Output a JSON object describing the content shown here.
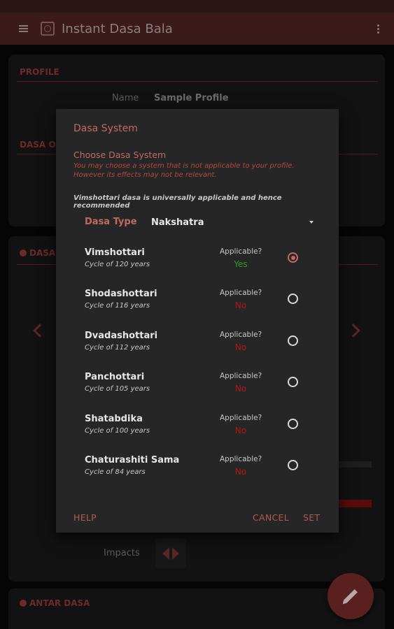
{
  "toolbar": {
    "title": "Instant Dasa Bala"
  },
  "background": {
    "profile_header": "PROFILE",
    "name_label": "Name",
    "name_value": "Sample Profile",
    "dasa_o_header": "DASA O",
    "dasa_header": "DASA",
    "impacts_label": "Impacts",
    "antar_header": "ANTAR DASA"
  },
  "dialog": {
    "title": "Dasa System",
    "subtitle": "Choose Dasa System",
    "note": "You may choose a system that is not applicable to your profile. However its effects may not be relevant.",
    "recommendation": "Vimshottari dasa is universally applicable and hence recommended",
    "type_label": "Dasa Type",
    "type_value": "Nakshatra",
    "applicable_label": "Applicable?",
    "systems": [
      {
        "name": "Vimshottari",
        "cycle": "Cycle of 120 years",
        "applicable": "Yes",
        "selected": true
      },
      {
        "name": "Shodashottari",
        "cycle": "Cycle of 116 years",
        "applicable": "No",
        "selected": false
      },
      {
        "name": "Dvadashottari",
        "cycle": "Cycle of 112 years",
        "applicable": "No",
        "selected": false
      },
      {
        "name": "Panchottari",
        "cycle": "Cycle of 105 years",
        "applicable": "No",
        "selected": false
      },
      {
        "name": "Shatabdika",
        "cycle": "Cycle of 100 years",
        "applicable": "No",
        "selected": false
      },
      {
        "name": "Chaturashiti Sama",
        "cycle": "Cycle of 84 years",
        "applicable": "No",
        "selected": false
      }
    ],
    "help_label": "HELP",
    "cancel_label": "CANCEL",
    "set_label": "SET"
  },
  "colors": {
    "accent": "#c06a62",
    "yes": "#2e9e2e",
    "no": "#b81414"
  },
  "icons": {
    "menu": "menu-icon",
    "logo": "app-logo-icon",
    "overflow": "overflow-menu-icon",
    "fab": "edit-pencil-icon"
  }
}
